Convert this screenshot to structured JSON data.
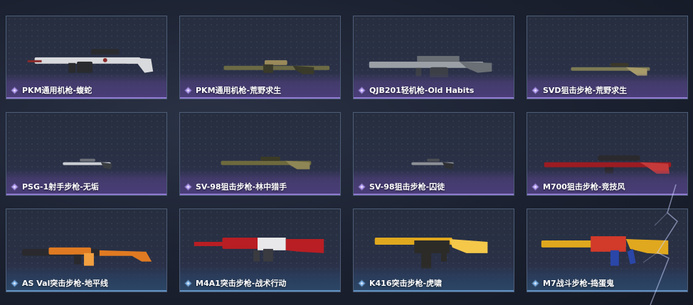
{
  "cards": [
    {
      "label": "PKM通用机枪-蝮蛇",
      "tier": "purple",
      "icon": "purple-diamond-icon",
      "weapon": "pkm-viper",
      "colors": [
        "#d9dadd",
        "#8a2b2b",
        "#2a2b2f"
      ]
    },
    {
      "label": "PKM通用机枪-荒野求生",
      "tier": "purple",
      "icon": "purple-diamond-icon",
      "weapon": "pkm-wild",
      "colors": [
        "#6b6a45",
        "#3a3a2a",
        "#9a8a5a"
      ]
    },
    {
      "label": "QJB201轻机枪-Old Habits",
      "tier": "purple",
      "icon": "purple-diamond-icon",
      "weapon": "qjb201",
      "colors": [
        "#9aa0a6",
        "#3c4046",
        "#6a6f75"
      ]
    },
    {
      "label": "SVD狙击步枪-荒野求生",
      "tier": "purple",
      "icon": "purple-diamond-icon",
      "weapon": "svd-wild",
      "colors": [
        "#7d7a55",
        "#3a382a",
        "#a89b6a"
      ]
    },
    {
      "label": "PSG-1射手步枪-无垢",
      "tier": "purple",
      "icon": "purple-diamond-icon",
      "weapon": "psg1",
      "colors": [
        "#c9ccd2",
        "#6d7178",
        "#3a3d42"
      ]
    },
    {
      "label": "SV-98狙击步枪-林中猎手",
      "tier": "purple",
      "icon": "purple-diamond-icon",
      "weapon": "sv98-hunter",
      "colors": [
        "#6e6a3e",
        "#3b3a26",
        "#8f8656"
      ]
    },
    {
      "label": "SV-98狙击步枪-囚徒",
      "tier": "purple",
      "icon": "purple-diamond-icon",
      "weapon": "sv98-prisoner",
      "colors": [
        "#8d9096",
        "#4a4d52",
        "#2e3034"
      ]
    },
    {
      "label": "M700狙击步枪-竞技风",
      "tier": "purple",
      "icon": "purple-diamond-icon",
      "weapon": "m700",
      "colors": [
        "#9b1c22",
        "#2a2a2e",
        "#c43a3a"
      ]
    },
    {
      "label": "AS Val突击步枪-地平线",
      "tier": "blue",
      "icon": "blue-diamond-icon",
      "weapon": "asval",
      "colors": [
        "#e07a22",
        "#2a2a2e",
        "#f2a040"
      ]
    },
    {
      "label": "M4A1突击步枪-战术行动",
      "tier": "blue",
      "icon": "blue-diamond-icon",
      "weapon": "m4a1",
      "colors": [
        "#b81e24",
        "#e8e8ea",
        "#3a3b40"
      ]
    },
    {
      "label": "K416突击步枪-虎啸",
      "tier": "blue",
      "icon": "blue-diamond-icon",
      "weapon": "k416",
      "colors": [
        "#e0a81e",
        "#2c2b28",
        "#f5c84a"
      ]
    },
    {
      "label": "M7战斗步枪-捣蛋鬼",
      "tier": "blue",
      "icon": "blue-diamond-icon",
      "weapon": "m7",
      "colors": [
        "#e0a81e",
        "#2a46a8",
        "#d23a2a"
      ]
    }
  ]
}
